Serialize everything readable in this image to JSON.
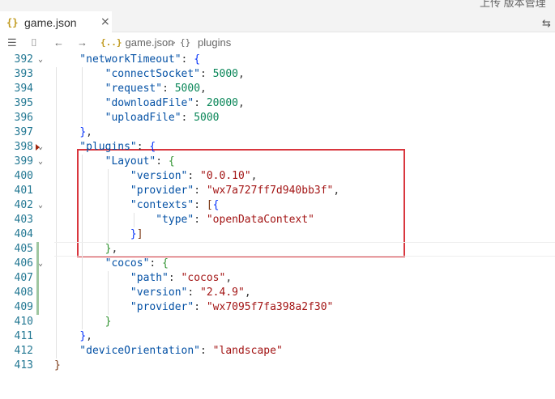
{
  "tab": {
    "file_icon": "{}",
    "label": "game.json",
    "close": "×"
  },
  "top_right_text": "上传 版本管理",
  "breadcrumb": {
    "list_icon": "☰",
    "bookmark_icon": "⌷",
    "back_icon": "←",
    "forward_icon": "→",
    "file_icon": "{..}",
    "file": "game.json",
    "separator": ">",
    "symbol_icon": "{}",
    "symbol": "plugins"
  },
  "editor": {
    "lines": [
      {
        "number": "392",
        "fold": "⌄",
        "segments": [
          {
            "t": "    \"networkTimeout\"",
            "c": "k"
          },
          {
            "t": ": ",
            "c": "p"
          },
          {
            "t": "{",
            "c": "b1"
          }
        ]
      },
      {
        "number": "393",
        "segments": [
          {
            "t": "        \"connectSocket\"",
            "c": "k"
          },
          {
            "t": ": ",
            "c": "p"
          },
          {
            "t": "5000",
            "c": "n"
          },
          {
            "t": ",",
            "c": "p"
          }
        ]
      },
      {
        "number": "394",
        "segments": [
          {
            "t": "        \"request\"",
            "c": "k"
          },
          {
            "t": ": ",
            "c": "p"
          },
          {
            "t": "5000",
            "c": "n"
          },
          {
            "t": ",",
            "c": "p"
          }
        ]
      },
      {
        "number": "395",
        "segments": [
          {
            "t": "        \"downloadFile\"",
            "c": "k"
          },
          {
            "t": ": ",
            "c": "p"
          },
          {
            "t": "20000",
            "c": "n"
          },
          {
            "t": ",",
            "c": "p"
          }
        ]
      },
      {
        "number": "396",
        "segments": [
          {
            "t": "        \"uploadFile\"",
            "c": "k"
          },
          {
            "t": ": ",
            "c": "p"
          },
          {
            "t": "5000",
            "c": "n"
          }
        ]
      },
      {
        "number": "397",
        "segments": [
          {
            "t": "    ",
            "c": "p"
          },
          {
            "t": "}",
            "c": "b1"
          },
          {
            "t": ",",
            "c": "p"
          }
        ]
      },
      {
        "number": "398",
        "fold": "⌄",
        "segments": [
          {
            "t": "    \"plugins\"",
            "c": "k"
          },
          {
            "t": ": ",
            "c": "p"
          },
          {
            "t": "{",
            "c": "b1"
          }
        ]
      },
      {
        "number": "399",
        "fold": "⌄",
        "segments": [
          {
            "t": "        \"Layout\"",
            "c": "k"
          },
          {
            "t": ": ",
            "c": "p"
          },
          {
            "t": "{",
            "c": "b2"
          }
        ]
      },
      {
        "number": "400",
        "segments": [
          {
            "t": "            \"version\"",
            "c": "k"
          },
          {
            "t": ": ",
            "c": "p"
          },
          {
            "t": "\"0.0.10\"",
            "c": "s"
          },
          {
            "t": ",",
            "c": "p"
          }
        ]
      },
      {
        "number": "401",
        "segments": [
          {
            "t": "            \"provider\"",
            "c": "k"
          },
          {
            "t": ": ",
            "c": "p"
          },
          {
            "t": "\"wx7a727ff7d940bb3f\"",
            "c": "s"
          },
          {
            "t": ",",
            "c": "p"
          }
        ]
      },
      {
        "number": "402",
        "fold": "⌄",
        "segments": [
          {
            "t": "            \"contexts\"",
            "c": "k"
          },
          {
            "t": ": ",
            "c": "p"
          },
          {
            "t": "[",
            "c": "b3"
          },
          {
            "t": "{",
            "c": "b1"
          }
        ]
      },
      {
        "number": "403",
        "segments": [
          {
            "t": "                \"type\"",
            "c": "k"
          },
          {
            "t": ": ",
            "c": "p"
          },
          {
            "t": "\"openDataContext\"",
            "c": "s"
          }
        ]
      },
      {
        "number": "404",
        "segments": [
          {
            "t": "            ",
            "c": "p"
          },
          {
            "t": "}",
            "c": "b1"
          },
          {
            "t": "]",
            "c": "b3"
          }
        ]
      },
      {
        "number": "405",
        "segments": [
          {
            "t": "        ",
            "c": "p"
          },
          {
            "t": "}",
            "c": "b2"
          },
          {
            "t": ",",
            "c": "p"
          }
        ]
      },
      {
        "number": "406",
        "fold": "⌄",
        "segments": [
          {
            "t": "        \"cocos\"",
            "c": "k"
          },
          {
            "t": ": ",
            "c": "p"
          },
          {
            "t": "{",
            "c": "b2"
          }
        ]
      },
      {
        "number": "407",
        "segments": [
          {
            "t": "            \"path\"",
            "c": "k"
          },
          {
            "t": ": ",
            "c": "p"
          },
          {
            "t": "\"cocos\"",
            "c": "s"
          },
          {
            "t": ",",
            "c": "p"
          }
        ]
      },
      {
        "number": "408",
        "segments": [
          {
            "t": "            \"version\"",
            "c": "k"
          },
          {
            "t": ": ",
            "c": "p"
          },
          {
            "t": "\"2.4.9\"",
            "c": "s"
          },
          {
            "t": ",",
            "c": "p"
          }
        ]
      },
      {
        "number": "409",
        "segments": [
          {
            "t": "            \"provider\"",
            "c": "k"
          },
          {
            "t": ": ",
            "c": "p"
          },
          {
            "t": "\"wx7095f7fa398a2f30\"",
            "c": "s"
          }
        ]
      },
      {
        "number": "410",
        "segments": [
          {
            "t": "        ",
            "c": "p"
          },
          {
            "t": "}",
            "c": "b2"
          }
        ]
      },
      {
        "number": "411",
        "segments": [
          {
            "t": "    ",
            "c": "p"
          },
          {
            "t": "}",
            "c": "b1"
          },
          {
            "t": ",",
            "c": "p"
          }
        ]
      },
      {
        "number": "412",
        "segments": [
          {
            "t": "    \"deviceOrientation\"",
            "c": "k"
          },
          {
            "t": ": ",
            "c": "p"
          },
          {
            "t": "\"landscape\"",
            "c": "s"
          }
        ]
      },
      {
        "number": "413",
        "segments": [
          {
            "t": "}",
            "c": "b3"
          }
        ]
      }
    ]
  },
  "colors": {
    "key": "#0451a5",
    "string": "#a31515",
    "number": "#098658",
    "highlight_box": "#d9363e",
    "line_number": "#237893"
  }
}
